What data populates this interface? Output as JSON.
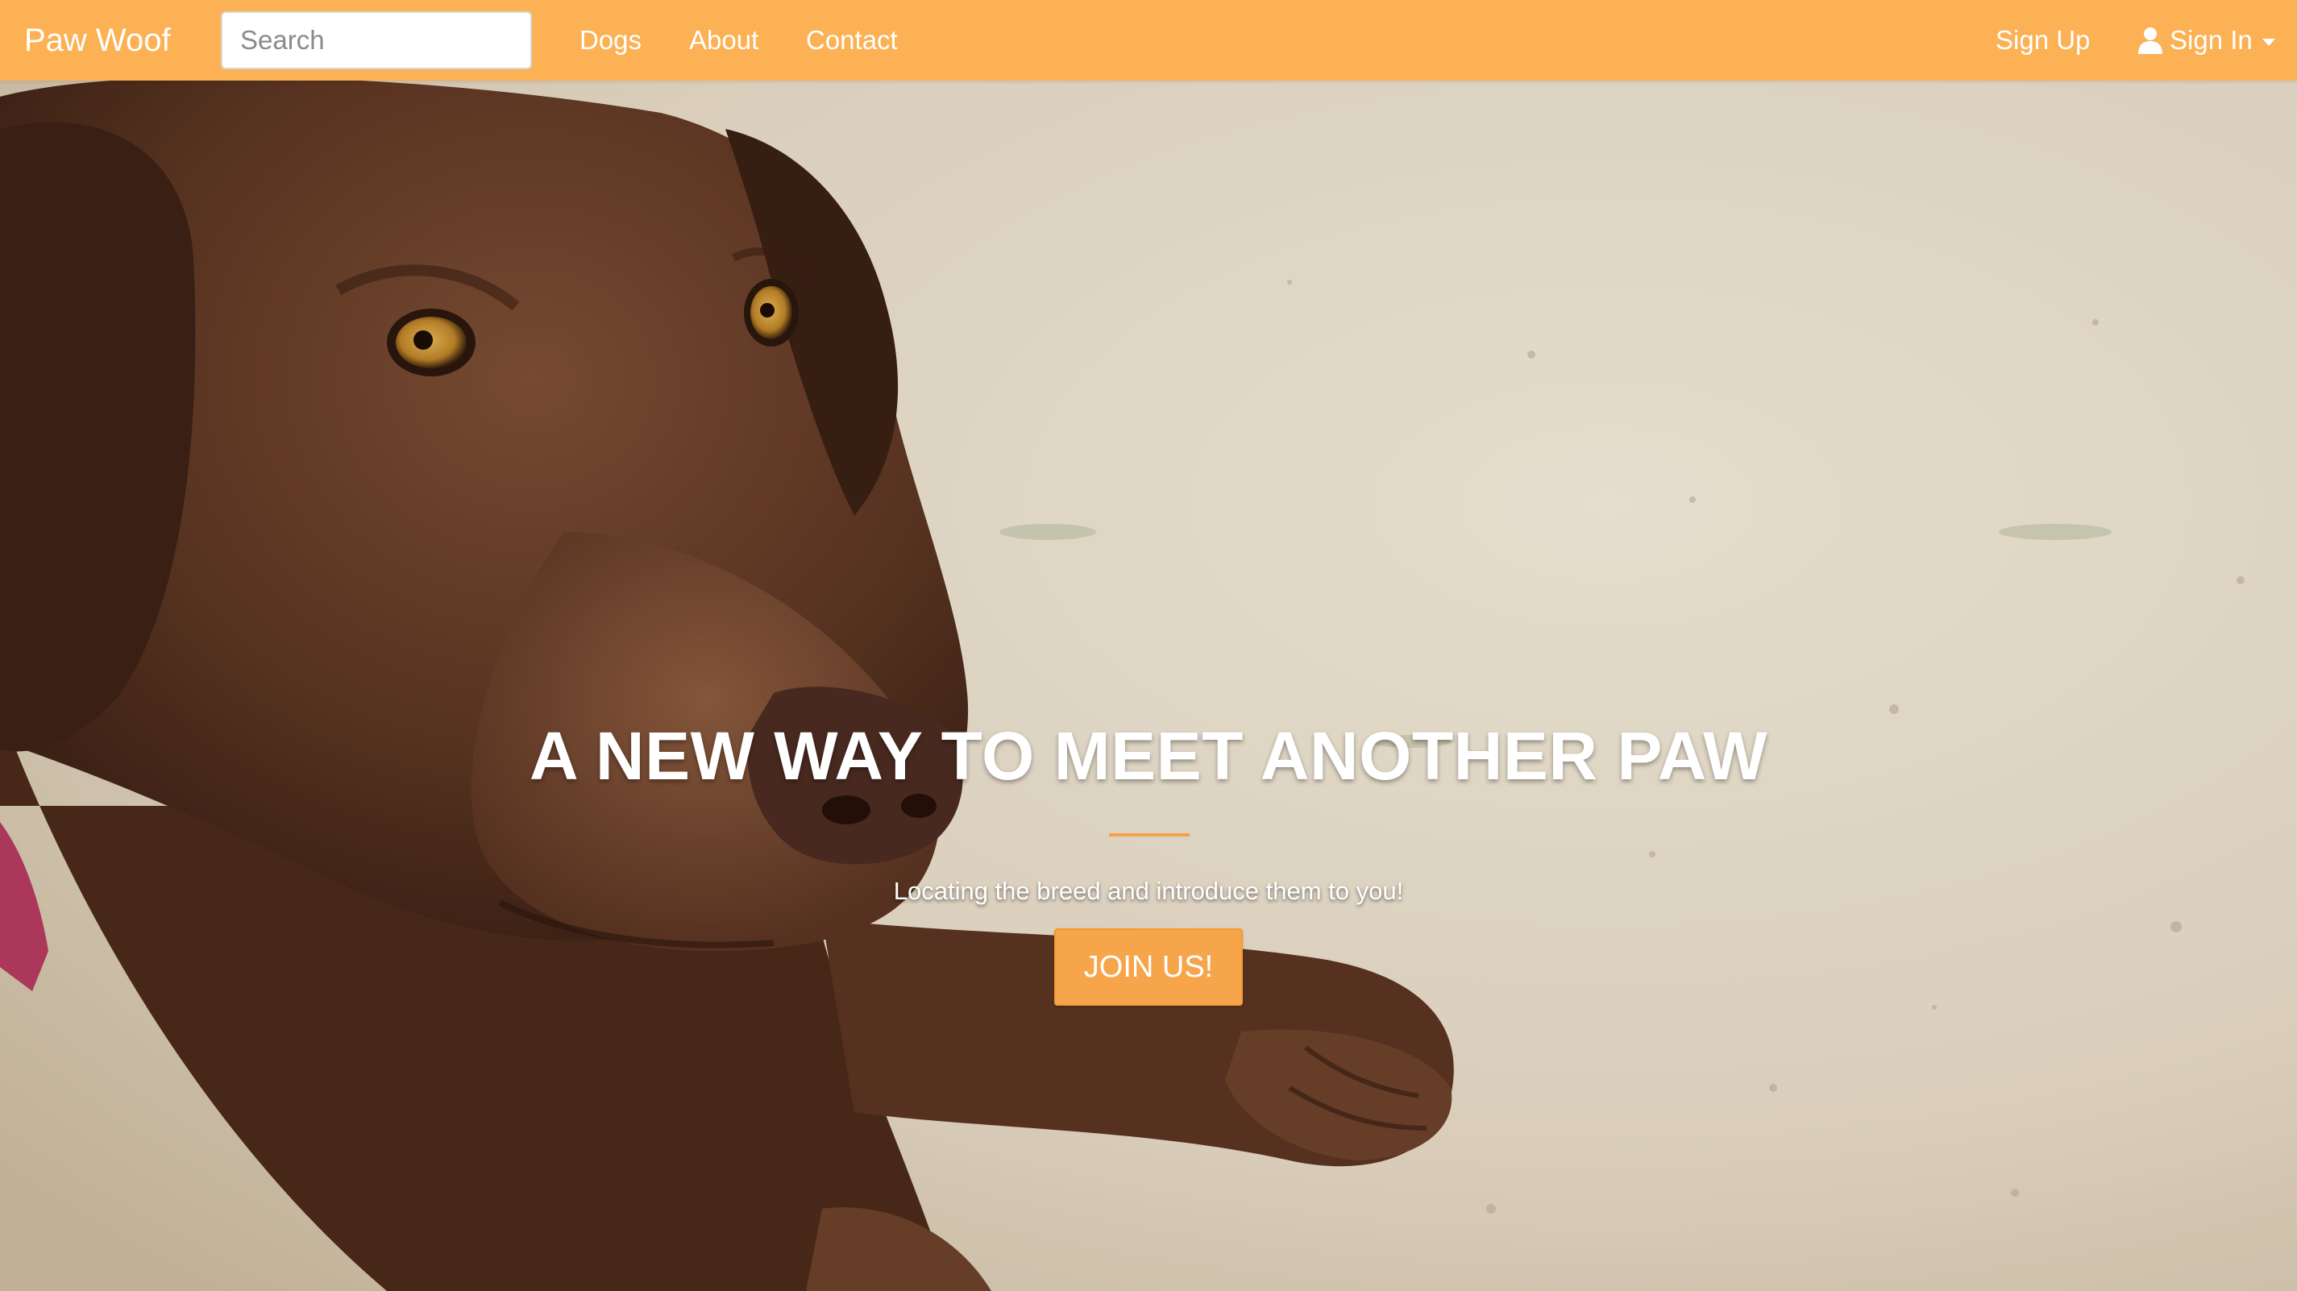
{
  "navbar": {
    "brand": "Paw Woof",
    "search_placeholder": "Search",
    "links": [
      "Dogs",
      "About",
      "Contact"
    ],
    "sign_up": "Sign Up",
    "sign_in": "Sign In",
    "background_color": "#fbb154"
  },
  "hero": {
    "title": "A NEW WAY TO MEET ANOTHER PAW",
    "subtitle": "Locating the breed and introduce them to you!",
    "cta": "JOIN US!",
    "accent_color": "#f7a54a"
  }
}
